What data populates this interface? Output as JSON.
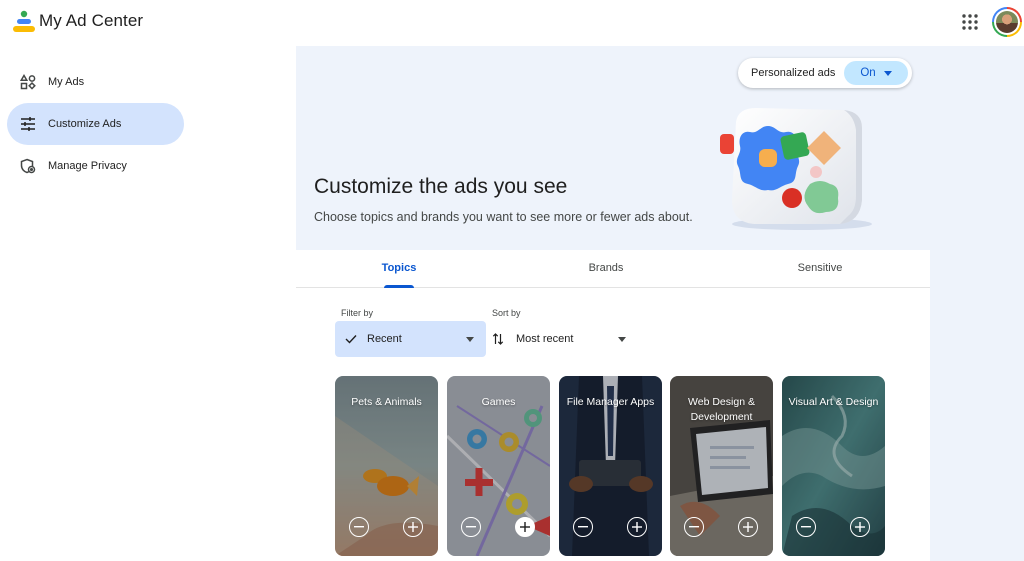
{
  "app": {
    "title": "My Ad Center",
    "logo_icon": "my-ad-center-logo",
    "apps_icon": "apps-grid-icon",
    "avatar_icon": "user-avatar"
  },
  "sidebar": {
    "items": [
      {
        "label": "My Ads",
        "icon": "shapes-icon",
        "active": false
      },
      {
        "label": "Customize Ads",
        "icon": "tune-icon",
        "active": true
      },
      {
        "label": "Manage Privacy",
        "icon": "privacy-shield-icon",
        "active": false
      }
    ]
  },
  "hero": {
    "title": "Customize the ads you see",
    "subtitle": "Choose topics and brands you want to see more or fewer ads about.",
    "personalized_label": "Personalized ads",
    "personalized_value": "On"
  },
  "tabs": [
    {
      "label": "Topics",
      "active": true
    },
    {
      "label": "Brands",
      "active": false
    },
    {
      "label": "Sensitive",
      "active": false
    }
  ],
  "filters": {
    "filter_label": "Filter by",
    "filter_value": "Recent",
    "sort_label": "Sort by",
    "sort_value": "Most recent"
  },
  "cards": [
    {
      "title": "Pets & Animals",
      "plus_selected": false
    },
    {
      "title": "Games",
      "plus_selected": true
    },
    {
      "title": "File Manager Apps",
      "plus_selected": false
    },
    {
      "title": "Web Design & Development",
      "plus_selected": false
    },
    {
      "title": "Visual Art & Design",
      "plus_selected": false
    }
  ],
  "colors": {
    "accent": "#0b57d0",
    "active_nav": "#d3e3fd",
    "toggle_bg": "#c2e7ff",
    "page_bg": "#eef3fb"
  }
}
